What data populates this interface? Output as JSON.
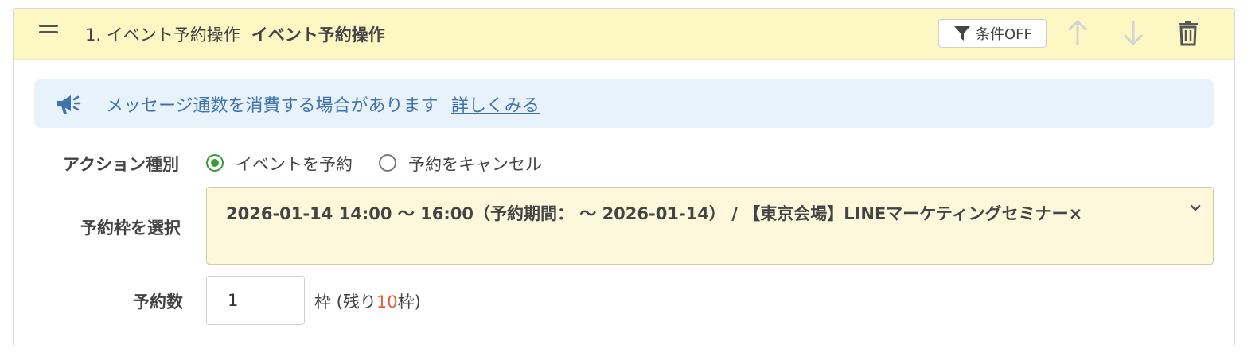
{
  "header": {
    "step_number": "1. イベント予約操作",
    "step_title": "イベント予約操作",
    "condition_button_label": "条件OFF"
  },
  "notice": {
    "message": "メッセージ通数を消費する場合があります",
    "link_label": "詳しくみる"
  },
  "form": {
    "action_type_label": "アクション種別",
    "action_options": [
      {
        "label": "イベントを予約",
        "selected": true
      },
      {
        "label": "予約をキャンセル",
        "selected": false
      }
    ],
    "slot_label": "予約枠を選択",
    "slot_value": "2026-01-14 14:00 〜 16:00（予約期間： 〜 2026-01-14） / 【東京会場】LINEマーケティングセミナー",
    "clear_symbol": "×",
    "quantity_label": "予約数",
    "quantity_value": "1",
    "remaining_prefix": "枠  (残り",
    "remaining_count": "10",
    "remaining_suffix": "枠)"
  },
  "colors": {
    "header_bg": "#fdf7c4",
    "notice_bg": "#e8f2fa",
    "accent_blue": "#3f73b0",
    "radio_green": "#3c9a3c",
    "remaining_red": "#e0603a"
  }
}
